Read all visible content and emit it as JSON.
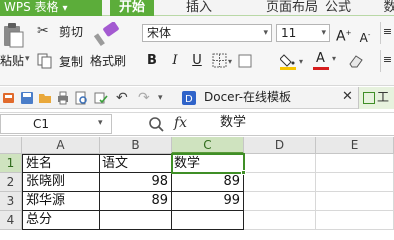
{
  "app": {
    "name": "WPS 表格"
  },
  "tabs": {
    "home": "开始",
    "insert": "插入",
    "layout": "页面布局",
    "formula": "公式",
    "data": "数"
  },
  "ribbon": {
    "paste": "粘贴",
    "cut": "剪切",
    "copy": "复制",
    "format_painter": "格式刷",
    "font_name": "宋体",
    "font_size": "11",
    "bold": "B",
    "italic": "I",
    "underline": "U",
    "font_color_letter": "A",
    "grow_font": "A",
    "shrink_font": "A"
  },
  "quick_access": {
    "doc_tab": "Docer-在线模板",
    "close": "✕",
    "second_tab_letter": "工"
  },
  "formula_bar": {
    "name_box": "C1",
    "fx": "fx",
    "value": "数学"
  },
  "grid": {
    "columns": [
      "A",
      "B",
      "C",
      "D",
      "E"
    ],
    "rows": [
      "1",
      "2",
      "3",
      "4"
    ],
    "cells": {
      "A1": "姓名",
      "B1": "语文",
      "C1": "数学",
      "A2": "张晓刚",
      "B2": "98",
      "C2": "89",
      "A3": "郑华源",
      "B3": "89",
      "C3": "99",
      "A4": "总分"
    }
  },
  "colors": {
    "brand_green": "#5cad3a",
    "selection_green": "#3f8e26",
    "font_color_red": "#d61d1d",
    "highlight_yellow": "#f6c400"
  }
}
